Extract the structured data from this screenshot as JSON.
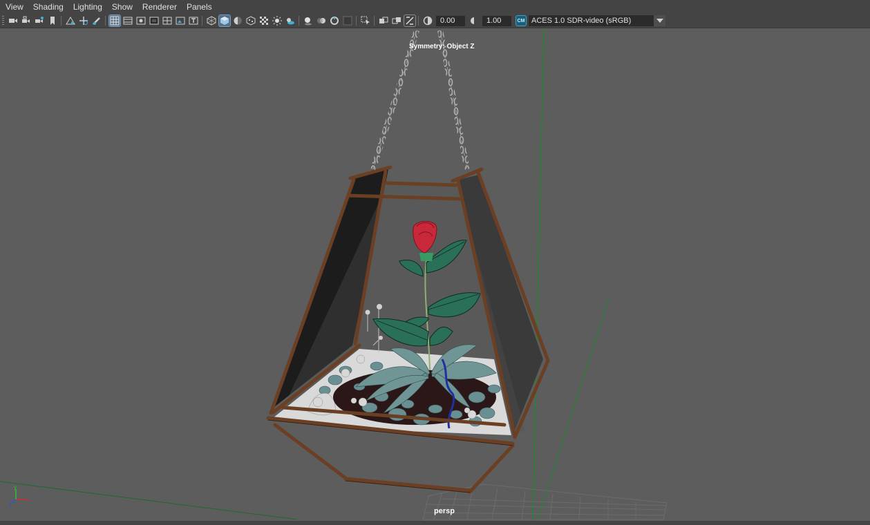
{
  "menu": [
    "View",
    "Shading",
    "Lighting",
    "Show",
    "Renderer",
    "Panels"
  ],
  "toolbar": {
    "exposure_value": "0.00",
    "gamma_value": "1.00",
    "color_management_badge": "CM",
    "view_transform": "ACES 1.0 SDR-video (sRGB)"
  },
  "viewport": {
    "symmetry_label": "Symmetry: Object Z",
    "camera_label": "persp",
    "axis_labels": {
      "x": "x",
      "y": "y",
      "z": "z"
    }
  },
  "colors": {
    "viewport_background": "#5d5d5d",
    "panel_background": "#444444",
    "wood_frame": "#6b3f24",
    "rose_red": "#c8283a",
    "leaf_green": "#2a7058",
    "pebble_teal": "#6a8f92",
    "axis_x": "#d03030",
    "axis_y": "#30c030",
    "axis_z": "#3050e0"
  },
  "icons": [
    "camera-select-icon",
    "camera-lock-icon",
    "camera-attributes-icon",
    "bookmark-icon",
    "image-plane-icon",
    "2d-pan-zoom-icon",
    "grease-pencil-icon",
    "grid-icon",
    "film-gate-icon",
    "resolution-gate-icon",
    "gate-mask-icon",
    "field-chart-icon",
    "safe-action-icon",
    "safe-title-icon",
    "wireframe-icon",
    "smooth-shade-icon",
    "default-material-icon",
    "textured-icon",
    "xray-icon",
    "use-all-lights-icon",
    "shadows-icon",
    "screen-space-ao-icon",
    "motion-blur-icon",
    "anti-aliasing-icon",
    "depth-of-field-icon",
    "isolate-select-icon",
    "xray-joints-icon",
    "xray-active-icon",
    "backface-culling-icon",
    "exposure-icon",
    "gamma-icon",
    "color-management-icon",
    "chevron-down-icon"
  ]
}
